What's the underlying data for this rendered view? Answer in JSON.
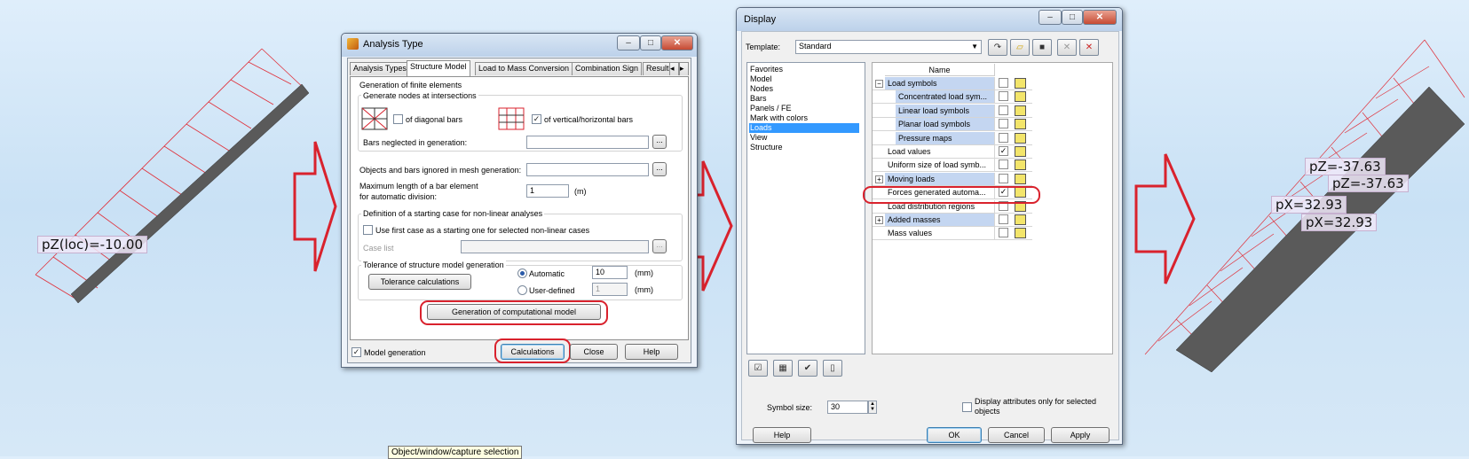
{
  "canvas": {
    "left_label": "pZ(loc)=-10.00",
    "right_labels": [
      "pZ=-37.63",
      "pZ=-37.63",
      "pX=32.93",
      "pX=32.93"
    ]
  },
  "analysis_dialog": {
    "title": "Analysis Type",
    "tabs": [
      "Analysis Types",
      "Structure Model",
      "Load to Mass Conversion",
      "Combination Sign",
      "Result"
    ],
    "fe_group": "Generation of finite elements",
    "nodes_group": "Generate nodes at intersections",
    "diag_label": "of diagonal bars",
    "vh_label": "of vertical/horizontal bars",
    "vh_check": "✓",
    "bars_neglected": "Bars neglected in generation:",
    "objects_ignored": "Objects and bars ignored in mesh generation:",
    "max_length_1": "Maximum length of a bar element",
    "max_length_2": "for automatic division:",
    "max_length_value": "1",
    "max_length_unit": "(m)",
    "nonlinear_group": "Definition of a starting case for non-linear analyses",
    "use_first_case": "Use first case as a starting one for selected non-linear cases",
    "case_list": "Case list",
    "tolerance_group": "Tolerance of structure model generation",
    "tolerance_btn": "Tolerance calculations",
    "automatic": "Automatic",
    "auto_value": "10",
    "user_defined": "User-defined",
    "user_value": "1",
    "unit_mm": "(mm)",
    "generate_btn": "Generation of computational model",
    "model_generation": "Model generation",
    "model_check": "✓",
    "calculations": "Calculations",
    "close": "Close",
    "help": "Help",
    "ellipsis": "..."
  },
  "display_dialog": {
    "title": "Display",
    "template_label": "Template:",
    "template_value": "Standard",
    "categories": [
      "Favorites",
      "Model",
      "Nodes",
      "Bars",
      "Panels / FE",
      "Mark with colors",
      "Loads",
      "View",
      "Structure"
    ],
    "selected_category": "Loads",
    "name_header": "Name",
    "rows": [
      {
        "name": "Load symbols",
        "check": "",
        "expander": "−"
      },
      {
        "name": "Concentrated load sym...",
        "check": ""
      },
      {
        "name": "Linear load symbols",
        "check": ""
      },
      {
        "name": "Planar load symbols",
        "check": ""
      },
      {
        "name": "Pressure maps",
        "check": ""
      },
      {
        "name": "Load values",
        "check": "✓"
      },
      {
        "name": "Uniform size of load symb...",
        "check": ""
      },
      {
        "name": "Moving loads",
        "check": "",
        "expander": "+"
      },
      {
        "name": "Forces generated automa...",
        "check": "✓"
      },
      {
        "name": "Load distribution regions",
        "check": ""
      },
      {
        "name": "Added masses",
        "check": "",
        "expander": "+"
      },
      {
        "name": "Mass values",
        "check": ""
      }
    ],
    "symbol_size_label": "Symbol size:",
    "symbol_size_value": "30",
    "display_attr_1": "Display attributes only for selected",
    "display_attr_2": "objects",
    "help": "Help",
    "ok": "OK",
    "cancel": "Cancel",
    "apply": "Apply"
  },
  "tooltip": "Object/window/capture selection",
  "colors": {
    "highlight": "#d9222d",
    "load_lines": "#e0303a",
    "beam": "#5a5a5a"
  }
}
